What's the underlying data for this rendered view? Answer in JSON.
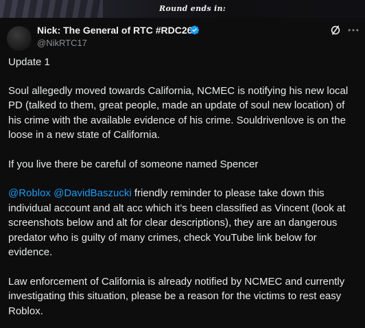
{
  "banner": {
    "text": "Round ends in:"
  },
  "tweet": {
    "display_name": "Nick: The General of RTC #RDC26",
    "handle": "@NikRTC17",
    "paragraphs": {
      "update": "Update 1",
      "soul": "Soul allegedly moved towards California, NCMEC is notifying his new local PD (talked to them, great people, made an update of soul new location) of his crime with the available evidence of his crime. Souldrivenlove is on the loose in a new state of California.",
      "ifyou": "If you live there be careful of someone named Spencer",
      "mention_1": "@Roblox",
      "mention_2": "@DavidBaszucki",
      "roblox_rest": " friendly reminder to please take down this individual account and alt acc which it’s been classified as Vincent (look at screenshots below and alt for clear descriptions), they are an dangerous predator who is guilty of many crimes, check YouTube link below for evidence.",
      "law": "Law enforcement of California is already notified by NCMEC and currently investigating this situation, please be a reason for the victims to rest easy Roblox."
    }
  },
  "colors": {
    "background": "#0d0d0d",
    "text": "#e7e9ea",
    "handle": "#8b8f94",
    "mention": "#1d9bf0",
    "verified": "#1d9bf0"
  },
  "icons": {
    "verified": "verified-badge-icon",
    "grok": "grok-icon",
    "more": "more-options-icon"
  }
}
